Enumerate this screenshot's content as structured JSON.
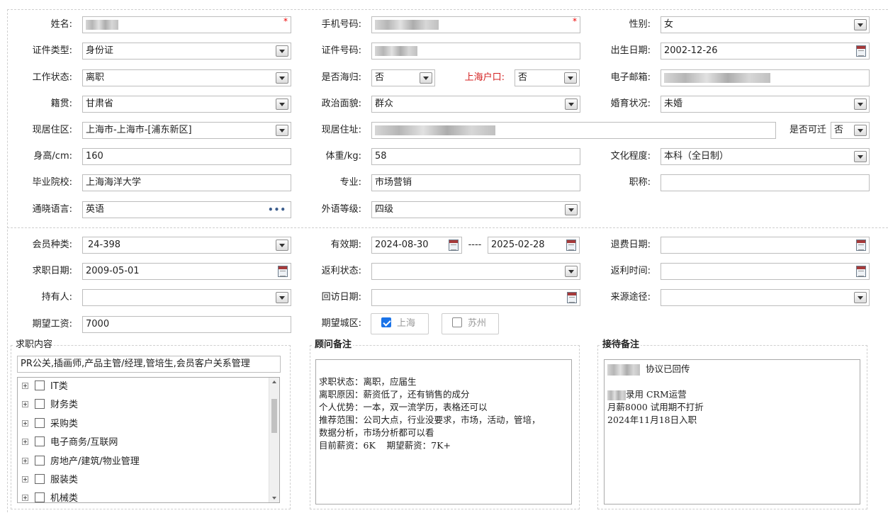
{
  "personal": {
    "name": {
      "label": "姓名:",
      "value": ""
    },
    "phone": {
      "label": "手机号码:",
      "value": ""
    },
    "gender": {
      "label": "性别:",
      "value": "女"
    },
    "id_type": {
      "label": "证件类型:",
      "value": "身份证"
    },
    "id_number": {
      "label": "证件号码:",
      "value": ""
    },
    "birthdate": {
      "label": "出生日期:",
      "value": "2002-12-26"
    },
    "work_status": {
      "label": "工作状态:",
      "value": "离职"
    },
    "returnee": {
      "label": "是否海归:",
      "value": "否"
    },
    "shanghai_hukou": {
      "label": "上海户口:",
      "value": "否"
    },
    "email": {
      "label": "电子邮箱:",
      "value": ""
    },
    "native_place": {
      "label": "籍贯:",
      "value": "甘肃省"
    },
    "political": {
      "label": "政治面貌:",
      "value": "群众"
    },
    "marital": {
      "label": "婚育状况:",
      "value": "未婚"
    },
    "district": {
      "label": "现居住区:",
      "value": "上海市-上海市-[浦东新区]"
    },
    "address": {
      "label": "现居住址:",
      "value": ""
    },
    "relocatable": {
      "label": "是否可迁",
      "value": "否"
    },
    "height": {
      "label": "身高/cm:",
      "value": "160"
    },
    "weight": {
      "label": "体重/kg:",
      "value": "58"
    },
    "education": {
      "label": "文化程度:",
      "value": "本科（全日制）"
    },
    "school": {
      "label": "毕业院校:",
      "value": "上海海洋大学"
    },
    "major": {
      "label": "专业:",
      "value": "市场营销"
    },
    "title": {
      "label": "职称:",
      "value": ""
    },
    "language": {
      "label": "通晓语言:",
      "value": "英语",
      "more": "•••"
    },
    "language_level": {
      "label": "外语等级:",
      "value": "四级"
    }
  },
  "membership": {
    "member_type": {
      "label": "会员种类:",
      "value": "24-398"
    },
    "validity": {
      "label": "有效期:",
      "from": "2024-08-30",
      "sep": "----",
      "to": "2025-02-28"
    },
    "refund_date": {
      "label": "退费日期:",
      "value": ""
    },
    "job_date": {
      "label": "求职日期:",
      "value": "2009-05-01"
    },
    "rebate_status": {
      "label": "返利状态:",
      "value": ""
    },
    "rebate_time": {
      "label": "返利时间:",
      "value": ""
    },
    "holder": {
      "label": "持有人:",
      "value": ""
    },
    "visit_date": {
      "label": "回访日期:",
      "value": ""
    },
    "source": {
      "label": "来源途径:",
      "value": ""
    },
    "salary": {
      "label": "期望工资:",
      "value": "7000"
    },
    "city_label": "期望城区:",
    "cities": [
      {
        "label": "上海",
        "checked": true
      },
      {
        "label": "苏州",
        "checked": false
      }
    ]
  },
  "job_content": {
    "legend": "求职内容",
    "selected": "PR公关,插画师,产品主管/经理,管培生,会员客户关系管理",
    "tree": [
      "IT类",
      "财务类",
      "采购类",
      "电子商务/互联网",
      "房地产/建筑/物业管理",
      "服装类",
      "机械类"
    ]
  },
  "consultant_notes": {
    "legend": "顾问备注",
    "text": "\n求职状态：离职，应届生\n离职原因：薪资低了，还有销售的成分\n个人优势：一本，双一流学历，表格还可以\n推荐范围：公司大点，行业没要求，市场，活动，管培，\n数据分析，市场分析都可以看\n目前薪资：6K    期望薪资：7K+"
  },
  "reception_notes": {
    "legend": "接待备注",
    "line1": "协议已回传",
    "line2": "录用 CRM运营",
    "line3": "月薪8000 试用期不打折",
    "line4": "2024年11月18日入职"
  }
}
